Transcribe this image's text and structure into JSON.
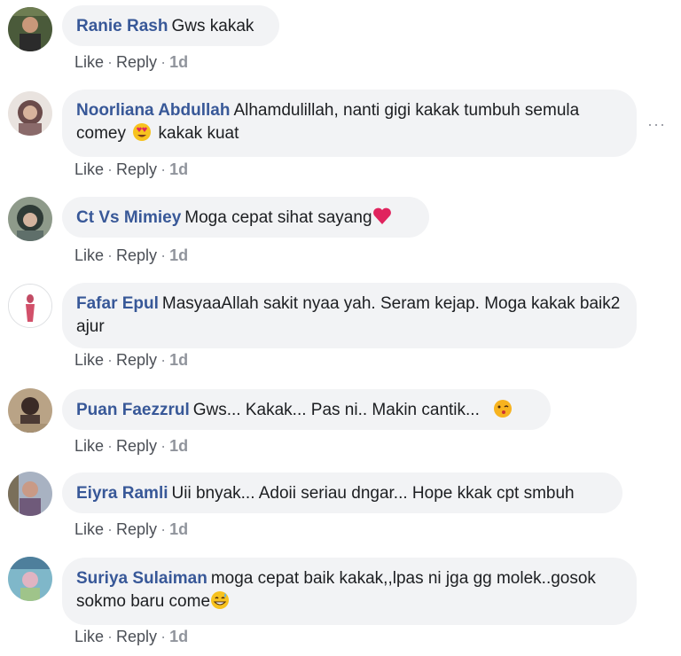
{
  "comments": [
    {
      "author": "Ranie Rash",
      "text": "Gws kakak",
      "actions": {
        "like": "Like",
        "reply": "Reply",
        "time": "1d"
      }
    },
    {
      "author": "Noorliana Abdullah",
      "text_a": "Alhamdulillah, nanti gigi kakak tumbuh semula comey",
      "emoji": "heart-eyes-emoji",
      "text_b": "kakak kuat",
      "actions": {
        "like": "Like",
        "reply": "Reply",
        "time": "1d"
      }
    },
    {
      "author": "Ct Vs Mimiey",
      "text": "Moga cepat sihat sayang",
      "emoji": "heart-emoji",
      "actions": {
        "like": "Like",
        "reply": "Reply",
        "time": "1d"
      }
    },
    {
      "author": "Fafar Epul",
      "text": "MasyaaAllah sakit nyaa yah. Seram kejap. Moga kakak baik2 ajur",
      "actions": {
        "like": "Like",
        "reply": "Reply",
        "time": "1d"
      }
    },
    {
      "author": "Puan Faezzrul",
      "text": "Gws... Kakak... Pas ni.. Makin cantik...",
      "emoji": "kiss-emoji",
      "actions": {
        "like": "Like",
        "reply": "Reply",
        "time": "1d"
      }
    },
    {
      "author": "Eiyra Ramli",
      "text": "Uii bnyak... Adoii seriau dngar... Hope kkak cpt smbuh",
      "actions": {
        "like": "Like",
        "reply": "Reply",
        "time": "1d"
      }
    },
    {
      "author": "Suriya Sulaiman",
      "text": "moga cepat baik kakak,,lpas ni jga gg molek..gosok sokmo baru come",
      "emoji": "grin-sweat-emoji",
      "actions": {
        "like": "Like",
        "reply": "Reply",
        "time": "1d"
      }
    }
  ],
  "more_icon": "ellipsis-icon",
  "more_label": "···",
  "colors": {
    "author": "#385898",
    "bubble": "#f2f3f5",
    "meta": "#90949c"
  }
}
